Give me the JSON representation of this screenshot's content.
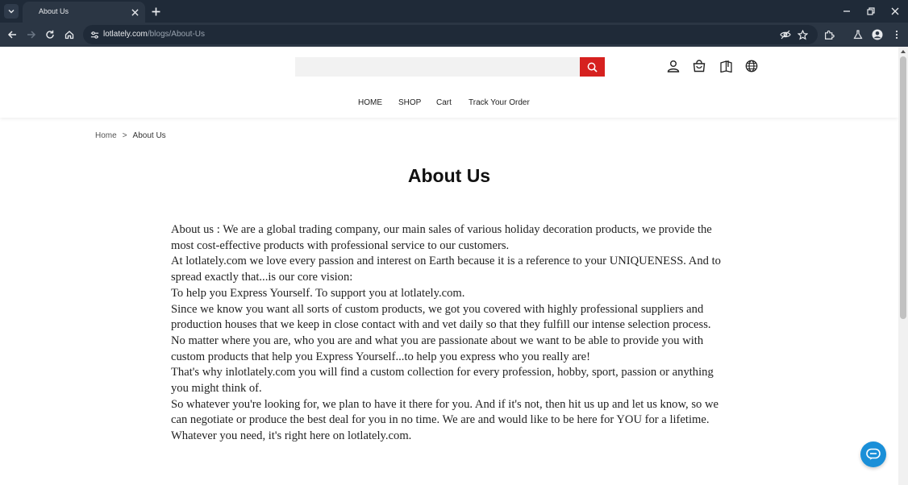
{
  "browser": {
    "tab_title": "About Us",
    "url_host": "lotlately.com",
    "url_path": "/blogs/About-Us"
  },
  "header": {
    "search_placeholder": "",
    "nav": [
      "HOME",
      "SHOP",
      "Cart",
      "Track Your Order"
    ]
  },
  "breadcrumb": {
    "home": "Home",
    "separator": ">",
    "current": "About Us"
  },
  "page": {
    "title": "About Us",
    "paragraphs": [
      "About us : We are a global trading company, our main sales of various holiday decoration products, we provide the most cost-effective products with professional service to our customers.",
      "At lotlately.com we love every passion and interest on Earth because it is a reference to your UNIQUENESS. And to spread exactly that...is our core vision:",
      "To help you Express Yourself. To support you at lotlately.com.",
      "Since we know you want all sorts of custom products, we got you covered with highly professional suppliers and production houses that we keep in close contact with and vet daily so that they fulfill our intense selection process.",
      "No matter where you are, who you are and what you are passionate about we want to be able to provide you with custom products that help you Express Yourself...to help you express who you really are!",
      "That's why inlotlately.com you will find a custom collection for every profession, hobby, sport, passion or anything you might think of.",
      "So whatever you're looking for, we plan to have it there for you. And if it's not, then hit us up and let us know, so we can negotiate or produce the best deal for you in no time. We are and would like to be here for YOU for a lifetime.",
      "Whatever you need, it's right here on lotlately.com."
    ]
  },
  "icons": {
    "search": "search-icon",
    "account": "user-icon",
    "cart": "shopping-bag-icon",
    "orders": "book-icon",
    "language": "globe-icon",
    "chat": "chat-icon"
  },
  "colors": {
    "accent": "#d6211f",
    "chat": "#1a8fd8",
    "chrome_dark": "#1f2a38",
    "chrome_toolbar": "#2b3644"
  }
}
